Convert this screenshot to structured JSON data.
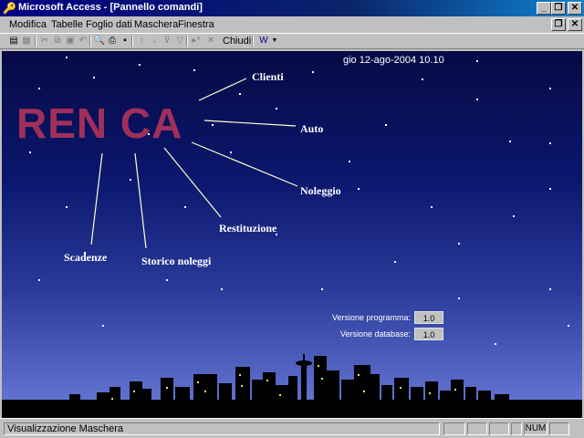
{
  "window": {
    "title": "Microsoft Access - [Pannello comandi]",
    "buttons": {
      "minimize": "_",
      "restore": "❐",
      "close": "✕"
    }
  },
  "menubar": {
    "items": [
      {
        "label": "Modifica"
      },
      {
        "label": "Tabelle"
      },
      {
        "label": "Foglio dati"
      },
      {
        "label": "Maschera"
      },
      {
        "label": "Finestra"
      }
    ]
  },
  "toolbar": {
    "close_label": "Chiudi",
    "icons": [
      "view-icon",
      "design-icon",
      "cut-icon",
      "copy-icon",
      "paste-icon",
      "undo-icon",
      "print-preview-icon",
      "print-icon",
      "save-icon",
      "sort-asc-icon",
      "sort-desc-icon",
      "filter-icon",
      "apply-filter-icon",
      "new-record-icon",
      "delete-record-icon",
      "office-links-icon"
    ]
  },
  "form": {
    "datetime": "gio 12-ago-2004 10.10",
    "logo": "REN CA",
    "links": [
      {
        "id": "clienti",
        "label": "Clienti"
      },
      {
        "id": "auto",
        "label": "Auto"
      },
      {
        "id": "noleggio",
        "label": "Noleggio"
      },
      {
        "id": "restituzione",
        "label": "Restituzione"
      },
      {
        "id": "storico",
        "label": "Storico noleggi"
      },
      {
        "id": "scadenze",
        "label": "Scadenze"
      }
    ],
    "version": {
      "program_label": "Versione programma:",
      "program_value": "1.0",
      "database_label": "Versione database:",
      "database_value": "1.0"
    },
    "colors": {
      "logo": "#a0305a",
      "sky_top": "#060a45",
      "sky_bottom": "#6b7bd8"
    }
  },
  "statusbar": {
    "text": "Visualizzazione Maschera",
    "num": "NUM"
  }
}
